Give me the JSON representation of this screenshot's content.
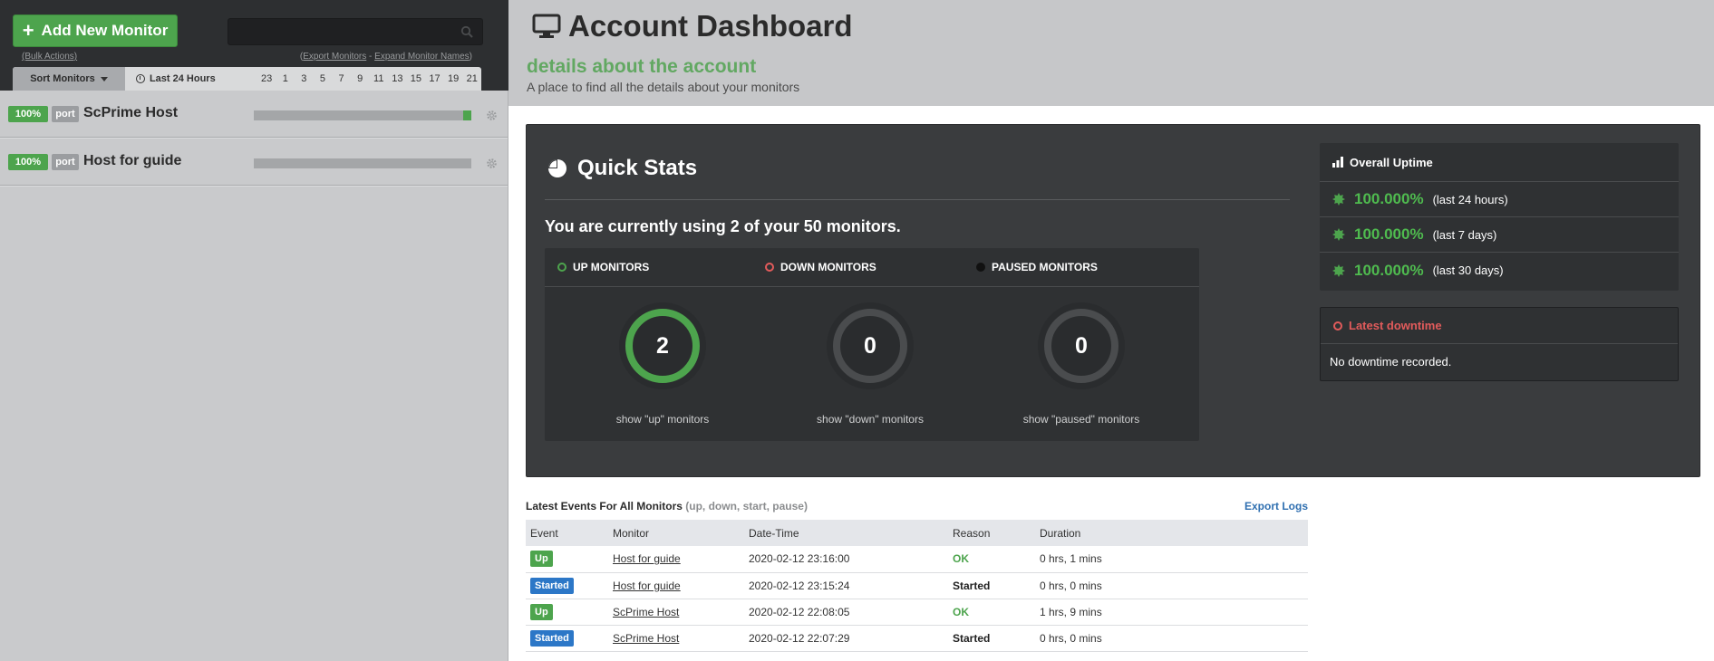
{
  "sidebar": {
    "add_button": "Add New Monitor",
    "search_placeholder": "",
    "bulk_actions": "(Bulk Actions)",
    "export_open": "(",
    "export_monitors": "Export Monitors",
    "export_sep": " - ",
    "expand_names": "Expand Monitor Names",
    "export_close": ")",
    "sort_label": "Sort Monitors",
    "range_label": "Last 24 Hours",
    "hours": [
      "23",
      "1",
      "3",
      "5",
      "7",
      "9",
      "11",
      "13",
      "15",
      "17",
      "19",
      "21"
    ],
    "monitors": [
      {
        "uptime": "100%",
        "type": "port",
        "name": "ScPrime Host",
        "recent_status": "up"
      },
      {
        "uptime": "100%",
        "type": "port",
        "name": "Host for guide",
        "recent_status": "none"
      }
    ]
  },
  "header": {
    "title": "Account Dashboard",
    "subtitle": "details about the account",
    "description": "A place to find all the details about your monitors"
  },
  "quick_stats": {
    "title": "Quick Stats",
    "usage": "You are currently using 2 of your 50 monitors.",
    "cards": [
      {
        "label": "UP MONITORS",
        "count": "2",
        "link": "show \"up\" monitors",
        "color": "#4da44d"
      },
      {
        "label": "DOWN MONITORS",
        "count": "0",
        "link": "show \"down\" monitors",
        "color": "#e25b5b"
      },
      {
        "label": "PAUSED MONITORS",
        "count": "0",
        "link": "show \"paused\" monitors",
        "color": "#111111"
      }
    ]
  },
  "overall_uptime": {
    "title": "Overall Uptime",
    "rows": [
      {
        "value": "100.000%",
        "label": "(last 24 hours)"
      },
      {
        "value": "100.000%",
        "label": "(last 7 days)"
      },
      {
        "value": "100.000%",
        "label": "(last 30 days)"
      }
    ]
  },
  "latest_downtime": {
    "title": "Latest downtime",
    "text": "No downtime recorded."
  },
  "events": {
    "title": "Latest Events For All Monitors",
    "filter": "(up, down, start, pause)",
    "export_logs": "Export Logs",
    "columns": [
      "Event",
      "Monitor",
      "Date-Time",
      "Reason",
      "Duration"
    ],
    "rows": [
      {
        "event": "Up",
        "monitor": "Host for guide",
        "datetime": "2020-02-12 23:16:00",
        "reason": "OK",
        "duration": "0 hrs, 1 mins"
      },
      {
        "event": "Started",
        "monitor": "Host for guide",
        "datetime": "2020-02-12 23:15:24",
        "reason": "Started",
        "duration": "0 hrs, 0 mins"
      },
      {
        "event": "Up",
        "monitor": "ScPrime Host",
        "datetime": "2020-02-12 22:08:05",
        "reason": "OK",
        "duration": "1 hrs, 9 mins"
      },
      {
        "event": "Started",
        "monitor": "ScPrime Host",
        "datetime": "2020-02-12 22:07:29",
        "reason": "Started",
        "duration": "0 hrs, 0 mins"
      }
    ]
  },
  "colors": {
    "brand_green": "#4da44d",
    "down_red": "#e25b5b",
    "started_blue": "#2c77c7",
    "panel_dark": "#3a3c3e"
  }
}
